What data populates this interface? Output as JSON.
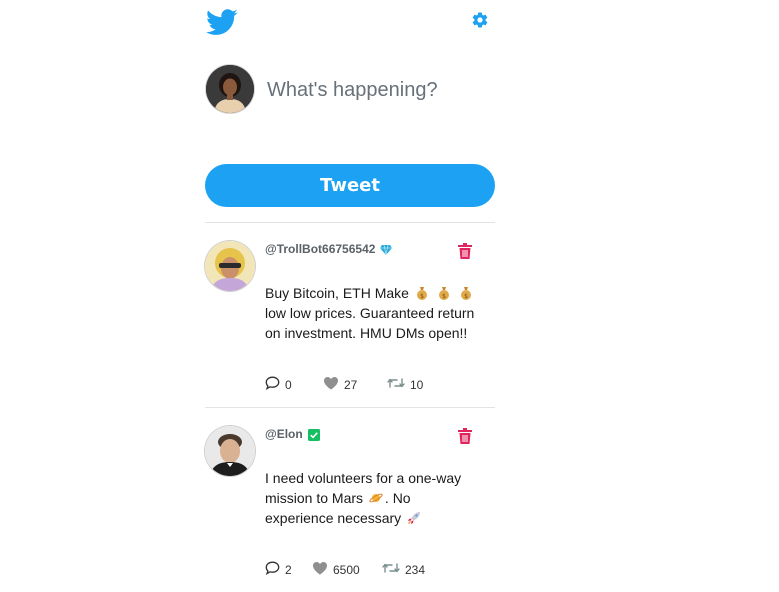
{
  "colors": {
    "brand": "#1da1f2",
    "delete": "#e0245e",
    "verified": "#17bf63",
    "gem": "#22a7d8"
  },
  "icons": {
    "logo": "twitter-bird-icon",
    "settings": "gear-icon",
    "reply": "comment-icon",
    "like": "heart-icon",
    "retweet": "retweet-icon",
    "delete": "trash-icon"
  },
  "composer": {
    "placeholder": "What's happening?",
    "button_label": "Tweet"
  },
  "tweets": [
    {
      "handle": "@TrollBot66756542",
      "badge": "gem",
      "text_prefix": "Buy Bitcoin, ETH Make",
      "text_emoji": "money-bag money-bag money-bag",
      "text_suffix": "low low prices. Guaranteed return on investment. HMU DMs open!!",
      "replies": "0",
      "likes": "27",
      "retweets": "10"
    },
    {
      "handle": "@Elon",
      "badge": "verified",
      "text_prefix": "I need volunteers for a one-way mission to Mars",
      "text_emoji": "planet",
      "text_suffix": ". No experience necessary",
      "text_tail_emoji": "rocket",
      "replies": "2",
      "likes": "6500",
      "retweets": "234"
    }
  ]
}
